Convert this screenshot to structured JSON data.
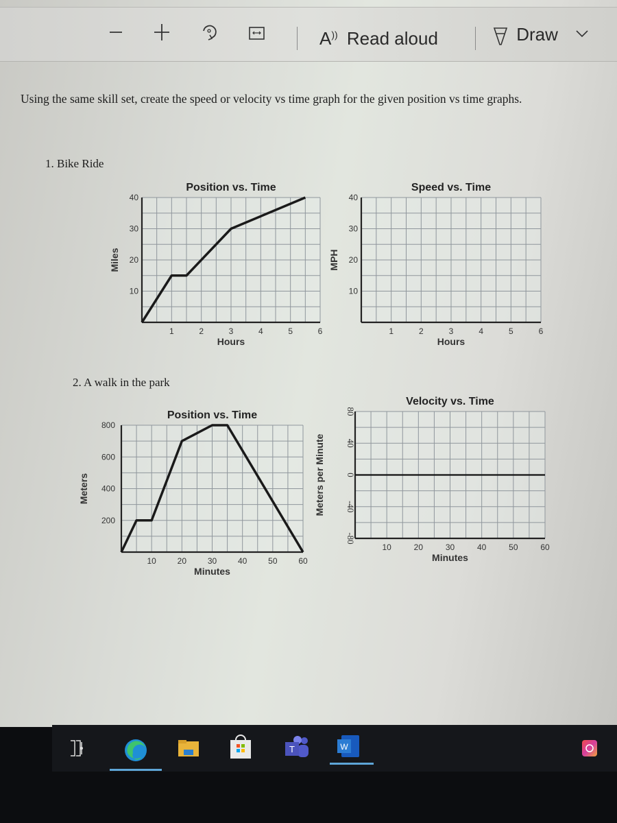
{
  "toolbar": {
    "zoom_out_icon": "minus-icon",
    "zoom_in_icon": "plus-icon",
    "rotate_icon": "rotate-icon",
    "fit_icon": "fit-width-icon",
    "read_aloud_label": "Read aloud",
    "draw_label": "Draw",
    "more_icon": "chevron-down-icon"
  },
  "document": {
    "instructions": "Using the same skill set, create the speed or velocity vs time graph for the given position vs time graphs.",
    "problem1_label": "1.  Bike Ride",
    "problem2_label": "2. A walk in the park"
  },
  "chart_data": [
    {
      "type": "line",
      "title": "Position vs. Time",
      "xlabel": "Hours",
      "ylabel": "Miles",
      "xlim": [
        0,
        6
      ],
      "ylim": [
        0,
        40
      ],
      "xticks": [
        1,
        2,
        3,
        4,
        5,
        6
      ],
      "yticks": [
        10,
        20,
        30,
        40
      ],
      "grid": true,
      "series": [
        {
          "name": "position",
          "x": [
            0,
            1,
            1.5,
            3,
            5.5
          ],
          "y": [
            0,
            15,
            15,
            30,
            40
          ]
        }
      ]
    },
    {
      "type": "line",
      "title": "Speed vs. Time",
      "xlabel": "Hours",
      "ylabel": "MPH",
      "xlim": [
        0,
        6
      ],
      "ylim": [
        0,
        40
      ],
      "xticks": [
        1,
        2,
        3,
        4,
        5,
        6
      ],
      "yticks": [
        10,
        20,
        30,
        40
      ],
      "grid": true,
      "series": []
    },
    {
      "type": "line",
      "title": "Position vs. Time",
      "xlabel": "Minutes",
      "ylabel": "Meters",
      "xlim": [
        0,
        60
      ],
      "ylim": [
        0,
        800
      ],
      "xticks": [
        10,
        20,
        30,
        40,
        50,
        60
      ],
      "yticks": [
        200,
        400,
        600,
        800
      ],
      "grid": true,
      "series": [
        {
          "name": "position",
          "x": [
            0,
            5,
            10,
            20,
            30,
            35,
            60
          ],
          "y": [
            0,
            200,
            200,
            700,
            800,
            800,
            0
          ]
        }
      ]
    },
    {
      "type": "line",
      "title": "Velocity   vs. Time",
      "xlabel": "Minutes",
      "ylabel": "Meters per Minute",
      "xlim": [
        0,
        60
      ],
      "ylim": [
        -80,
        80
      ],
      "xticks": [
        10,
        20,
        30,
        40,
        50,
        60
      ],
      "yticks": [
        -80,
        -40,
        0,
        40,
        80
      ],
      "grid": true,
      "zero_line": true,
      "series": []
    }
  ],
  "taskbar": {
    "apps": [
      {
        "name": "task-view-icon"
      },
      {
        "name": "edge-icon",
        "active": true
      },
      {
        "name": "file-explorer-icon"
      },
      {
        "name": "microsoft-store-icon"
      },
      {
        "name": "teams-icon",
        "label": "T"
      },
      {
        "name": "word-icon",
        "label": "W",
        "active": true
      },
      {
        "name": "creative-cloud-icon"
      }
    ]
  }
}
